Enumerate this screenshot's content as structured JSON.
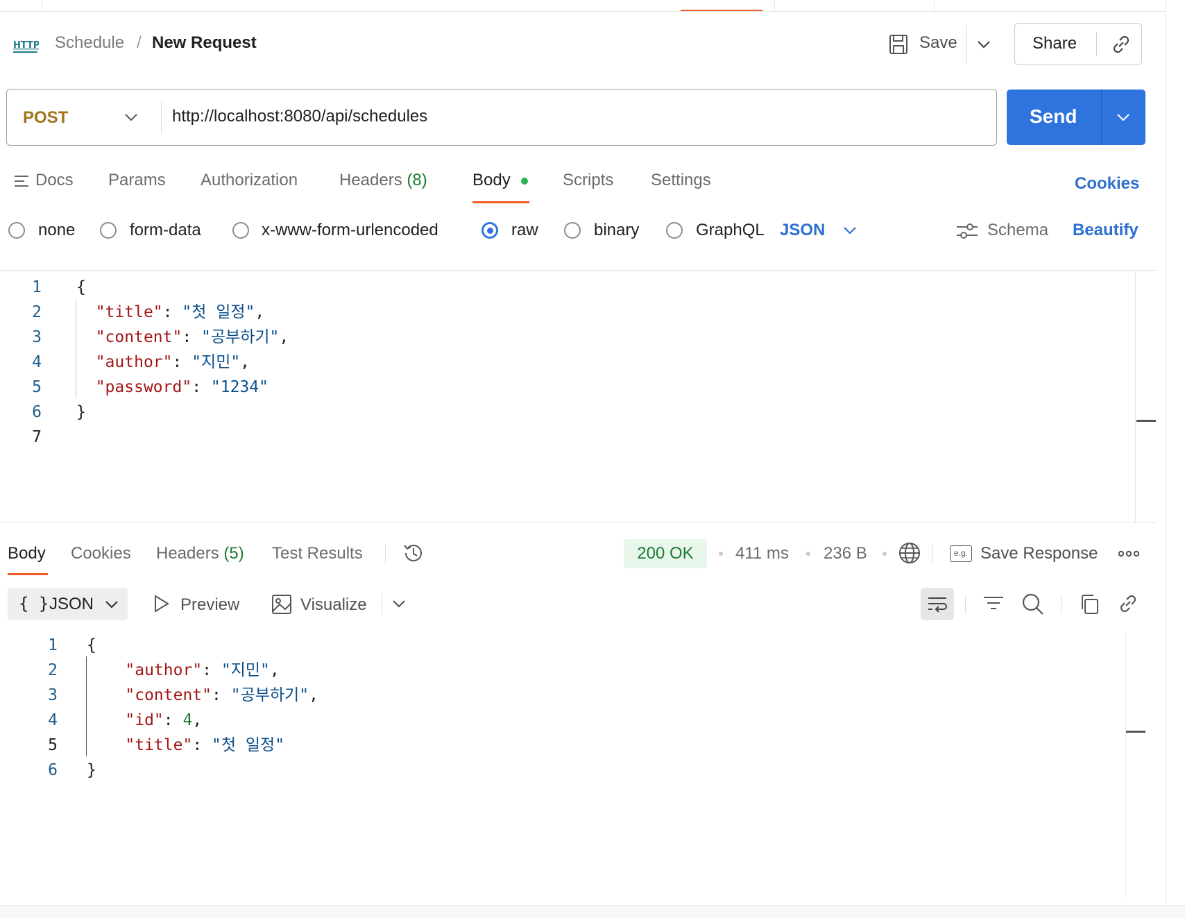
{
  "header": {
    "breadcrumb_parent": "Schedule",
    "breadcrumb_sep": "/",
    "request_name": "New Request",
    "save_label": "Save",
    "share_label": "Share"
  },
  "request": {
    "method": "POST",
    "method_color": "#a0741a",
    "url": "http://localhost:8080/api/schedules",
    "send_label": "Send",
    "send_color": "#2f74de"
  },
  "tabs": {
    "docs": "Docs",
    "params": "Params",
    "authorization": "Authorization",
    "headers": "Headers",
    "headers_count": "(8)",
    "body": "Body",
    "scripts": "Scripts",
    "settings": "Settings",
    "cookies": "Cookies"
  },
  "body_types": {
    "none": "none",
    "form_data": "form-data",
    "urlencoded": "x-www-form-urlencoded",
    "raw": "raw",
    "binary": "binary",
    "graphql": "GraphQL",
    "format": "JSON",
    "schema": "Schema",
    "beautify": "Beautify"
  },
  "request_body": {
    "line_numbers": [
      "1",
      "2",
      "3",
      "4",
      "5",
      "6",
      "7"
    ],
    "open": "{",
    "close": "}",
    "title_key": "\"title\"",
    "title_val": "\"첫 일정\"",
    "content_key": "\"content\"",
    "content_val": "\"공부하기\"",
    "author_key": "\"author\"",
    "author_val": "\"지민\"",
    "password_key": "\"password\"",
    "password_val": "\"1234\""
  },
  "response_tabs": {
    "body": "Body",
    "cookies": "Cookies",
    "headers": "Headers",
    "headers_count": "(5)",
    "test_results": "Test Results"
  },
  "response_meta": {
    "status": "200 OK",
    "time": "411 ms",
    "size": "236 B",
    "save_response": "Save Response",
    "eg": "e.g."
  },
  "response_toolbar": {
    "format": "JSON",
    "braces": "{ }",
    "preview": "Preview",
    "visualize": "Visualize"
  },
  "response_body": {
    "line_numbers": [
      "1",
      "2",
      "3",
      "4",
      "5",
      "6"
    ],
    "open": "{",
    "close": "}",
    "author_key": "\"author\"",
    "author_val": "\"지민\"",
    "content_key": "\"content\"",
    "content_val": "\"공부하기\"",
    "id_key": "\"id\"",
    "id_val": "4",
    "title_key": "\"title\"",
    "title_val": "\"첫 일정\""
  }
}
